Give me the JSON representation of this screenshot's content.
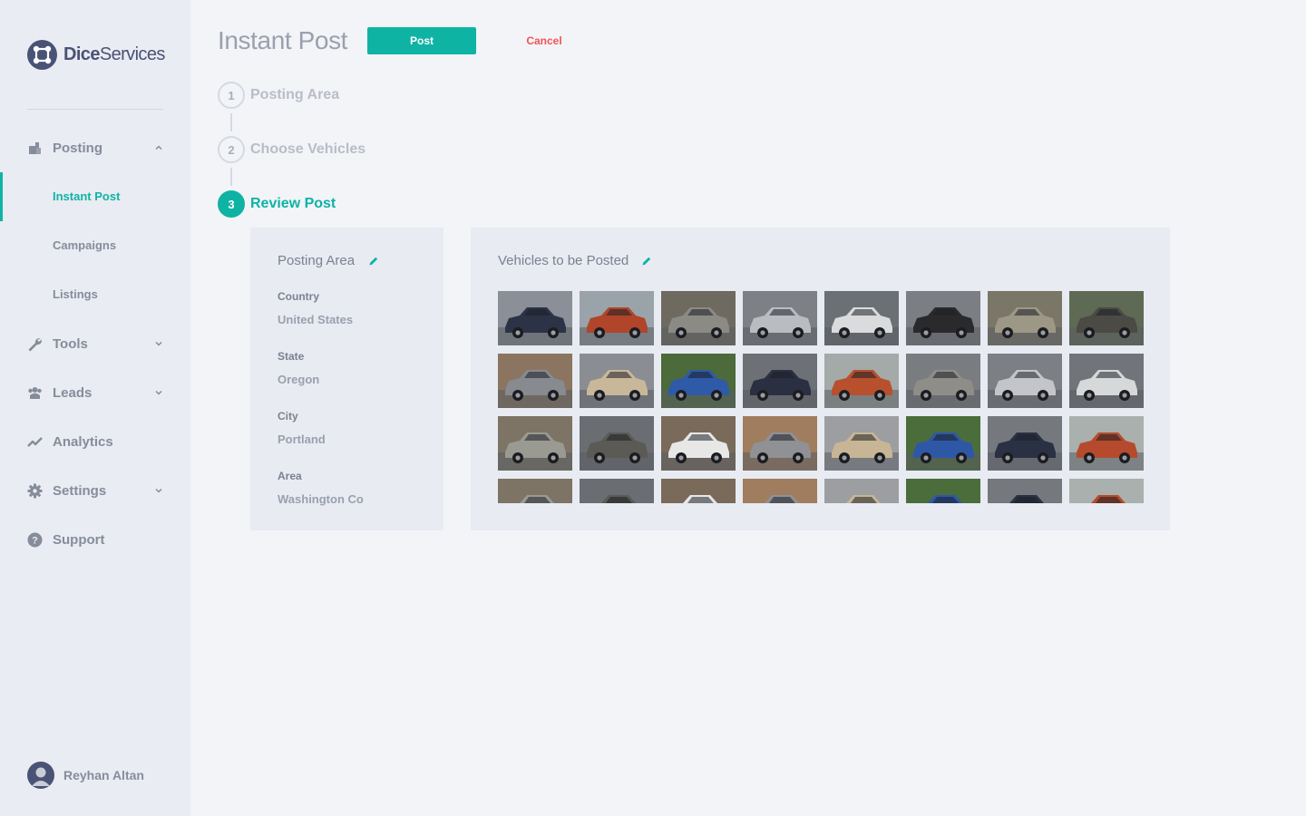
{
  "brand": {
    "name_bold": "Dice",
    "name_rest": "Services",
    "logo_icon": "dice-logo-icon"
  },
  "sidebar": {
    "items": [
      {
        "key": "posting",
        "label": "Posting",
        "icon": "posting-icon",
        "expanded": true
      },
      {
        "key": "tools",
        "label": "Tools",
        "icon": "wrench-icon",
        "expanded": false
      },
      {
        "key": "leads",
        "label": "Leads",
        "icon": "leads-icon",
        "expanded": false
      },
      {
        "key": "analytics",
        "label": "Analytics",
        "icon": "chart-line-icon"
      },
      {
        "key": "settings",
        "label": "Settings",
        "icon": "gear-icon",
        "expanded": false
      },
      {
        "key": "support",
        "label": "Support",
        "icon": "help-icon"
      }
    ],
    "subitems": [
      {
        "label": "Instant Post",
        "active": true
      },
      {
        "label": "Campaigns",
        "active": false
      },
      {
        "label": "Listings",
        "active": false
      }
    ]
  },
  "user": {
    "name": "Reyhan Altan"
  },
  "header": {
    "title": "Instant Post",
    "post_label": "Post",
    "cancel_label": "Cancel"
  },
  "stepper": {
    "steps": [
      {
        "number": "1",
        "label": "Posting Area",
        "active": false
      },
      {
        "number": "2",
        "label": "Choose Vehicles",
        "active": false
      },
      {
        "number": "3",
        "label": "Review Post",
        "active": true
      }
    ]
  },
  "posting_area": {
    "title": "Posting Area",
    "fields": [
      {
        "label": "Country",
        "value": "United States"
      },
      {
        "label": "State",
        "value": "Oregon"
      },
      {
        "label": "City",
        "value": "Portland"
      },
      {
        "label": "Area",
        "value": "Washington Co"
      }
    ]
  },
  "vehicles": {
    "title": "Vehicles to be Posted",
    "thumbnails": [
      {
        "car": "#2c3346",
        "bg": "#8a8f98"
      },
      {
        "car": "#b0452a",
        "bg": "#9aa3a9"
      },
      {
        "car": "#8c8a84",
        "bg": "#6f6a60"
      },
      {
        "car": "#b9bcc0",
        "bg": "#7d8085"
      },
      {
        "car": "#d9dbdc",
        "bg": "#6b7074"
      },
      {
        "car": "#2a2a2c",
        "bg": "#7b7f84"
      },
      {
        "car": "#9d9886",
        "bg": "#7a7668"
      },
      {
        "car": "#4c4a44",
        "bg": "#5f6a55"
      },
      {
        "car": "#878a8e",
        "bg": "#8b7560"
      },
      {
        "car": "#c9b79a",
        "bg": "#8a8d92"
      },
      {
        "car": "#2f5aa8",
        "bg": "#4c6a3a"
      },
      {
        "car": "#2a3042",
        "bg": "#6d7176"
      },
      {
        "car": "#b8502e",
        "bg": "#a3aaa8"
      },
      {
        "car": "#8f8d88",
        "bg": "#7a7d80"
      },
      {
        "car": "#c3c5c8",
        "bg": "#7c8085"
      },
      {
        "car": "#d6d8d9",
        "bg": "#717579"
      },
      {
        "car": "#9a9a92",
        "bg": "#7d7465"
      },
      {
        "car": "#5b5a55",
        "bg": "#6a6e72"
      },
      {
        "car": "#e6e7e6",
        "bg": "#7a6a5a"
      },
      {
        "car": "#8f9195",
        "bg": "#a07d5e"
      },
      {
        "car": "#c7b596",
        "bg": "#9c9ea2"
      },
      {
        "car": "#2e58a6",
        "bg": "#4b6d3b"
      },
      {
        "car": "#2b3144",
        "bg": "#75797e"
      },
      {
        "car": "#b54b2c",
        "bg": "#a9b0ad"
      },
      {
        "car": "#9a9a92",
        "bg": "#7d7465"
      },
      {
        "car": "#5b5a55",
        "bg": "#6a6e72"
      },
      {
        "car": "#e6e7e6",
        "bg": "#7a6a5a"
      },
      {
        "car": "#8f9195",
        "bg": "#a07d5e"
      },
      {
        "car": "#c7b596",
        "bg": "#9c9ea2"
      },
      {
        "car": "#2e58a6",
        "bg": "#4b6d3b"
      },
      {
        "car": "#2b3144",
        "bg": "#75797e"
      },
      {
        "car": "#b54b2c",
        "bg": "#a9b0ad"
      }
    ]
  },
  "colors": {
    "accent": "#0fb3a4",
    "danger": "#f05454",
    "sidebar_bg": "#e9ecf2",
    "page_bg": "#f2f4f8"
  }
}
